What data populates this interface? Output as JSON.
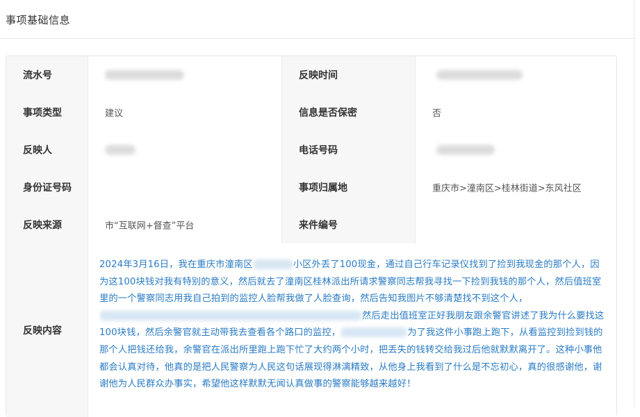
{
  "header": {
    "title": "事项基础信息"
  },
  "rows": [
    {
      "label1": "流水号",
      "value1": "",
      "label2": "反映时间",
      "value2": ""
    },
    {
      "label1": "事项类型",
      "value1": "建议",
      "label2": "信息是否保密",
      "value2": "否"
    },
    {
      "label1": "反映人",
      "value1": "",
      "label2": "电话号码",
      "value2": ""
    },
    {
      "label1": "身份证号码",
      "value1": "",
      "label2": "事项归属地",
      "value2": "重庆市>潼南区>桂林街道>东风社区"
    },
    {
      "label1": "反映来源",
      "value1": "市“互联网+督查”平台",
      "label2": "来件编号",
      "value2": ""
    }
  ],
  "content": {
    "label": "反映内容",
    "lines": [
      "2024年3月16日，我在重庆市潼南区",
      "小区外丢了100现金，通过自己行车记录仪找到了捡到我现金的那个人，因为这100块钱对我有特别的意义，然后就去了潼南区桂林派出所请求警察同志帮我寻找一下捡到我钱的那个人，然后值班室里的一个警察同志用我自己拍到的监控人脸帮我做了人脸查询，然后告知我图片不够清楚找不到这个人，",
      "然后走出值班室正好我朋友跟余警官讲述了我为什么要找这100块钱，然后余警官就主动带我去查看各个路口的监控，",
      "为了我这件小事跑上跑下，从看监控到捡到钱的那个人把钱还给我，余警官在派出所里跑上跑下忙了大约两个小时，把丢失的钱转交给我过后他就默默离开了。这种小事他都会认真对待，他真的是把人民警察为人民这句话展现得淋漓精致，从他身上我看到了什么是不忘初心，真的很感谢他，谢谢他为人民群众办事实，希望他这样默默无闻认真做事的警察能够越来越好！"
    ]
  }
}
